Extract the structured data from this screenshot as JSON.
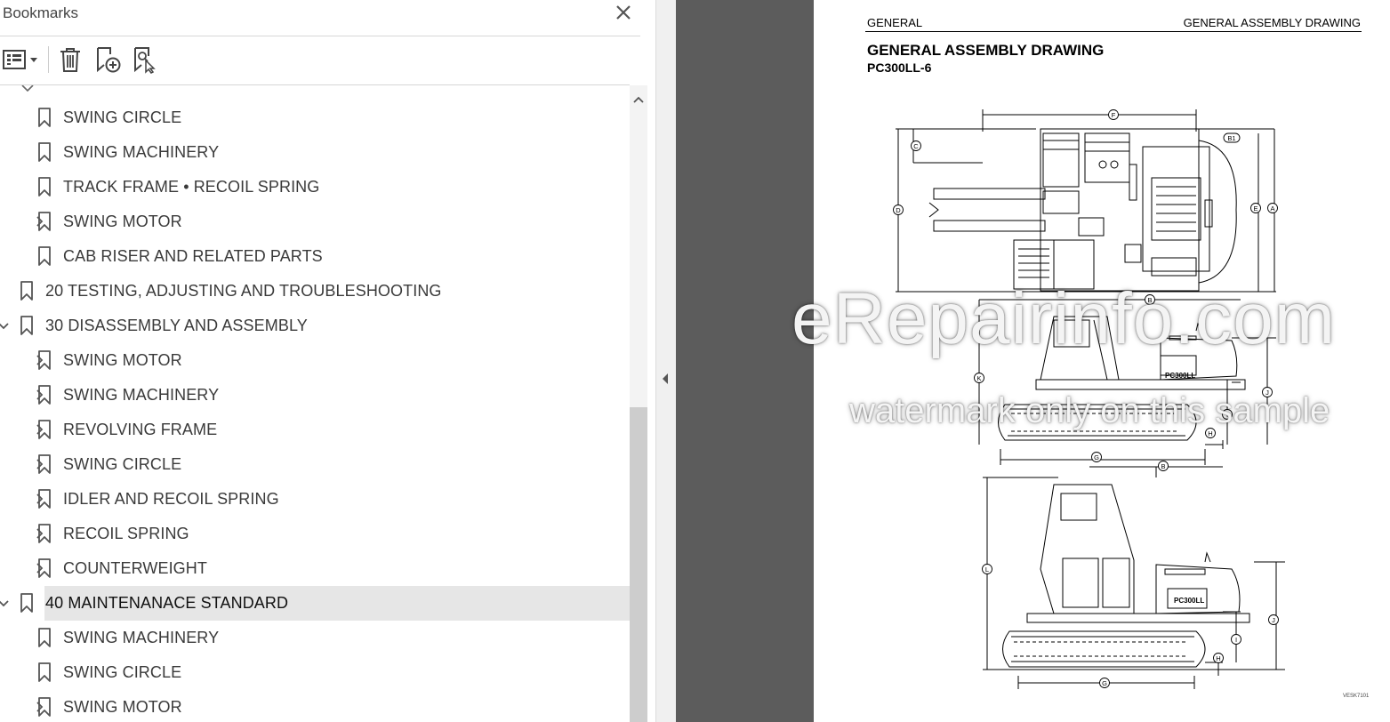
{
  "panel": {
    "title": "Bookmarks",
    "toolbar": {
      "options_icon": "list-options-icon",
      "delete_icon": "trash-icon",
      "new_bookmark_icon": "add-bookmark-icon",
      "find_bookmark_icon": "find-bookmark-icon"
    },
    "items": [
      {
        "label": "SWING CIRCLE",
        "level": 2,
        "expander": "none"
      },
      {
        "label": "SWING MACHINERY",
        "level": 2,
        "expander": "none"
      },
      {
        "label": "TRACK FRAME • RECOIL SPRING",
        "level": 2,
        "expander": "none"
      },
      {
        "label": "SWING MOTOR",
        "level": 2,
        "expander": "collapsed"
      },
      {
        "label": "CAB RISER AND RELATED PARTS",
        "level": 2,
        "expander": "none"
      },
      {
        "label": "20 TESTING, ADJUSTING AND TROUBLESHOOTING",
        "level": 1,
        "expander": "none"
      },
      {
        "label": "30 DISASSEMBLY AND ASSEMBLY",
        "level": 1,
        "expander": "expanded"
      },
      {
        "label": "SWING MOTOR",
        "level": 2,
        "expander": "collapsed"
      },
      {
        "label": "SWING MACHINERY",
        "level": 2,
        "expander": "collapsed"
      },
      {
        "label": "REVOLVING FRAME",
        "level": 2,
        "expander": "collapsed"
      },
      {
        "label": "SWING CIRCLE",
        "level": 2,
        "expander": "collapsed"
      },
      {
        "label": "IDLER AND RECOIL SPRING",
        "level": 2,
        "expander": "collapsed"
      },
      {
        "label": "RECOIL SPRING",
        "level": 2,
        "expander": "collapsed"
      },
      {
        "label": "COUNTERWEIGHT",
        "level": 2,
        "expander": "collapsed"
      },
      {
        "label": "40 MAINTENANACE STANDARD",
        "level": 1,
        "expander": "expanded",
        "selected": true
      },
      {
        "label": "SWING MACHINERY",
        "level": 2,
        "expander": "none"
      },
      {
        "label": "SWING CIRCLE",
        "level": 2,
        "expander": "none"
      },
      {
        "label": "SWING MOTOR",
        "level": 2,
        "expander": "collapsed"
      }
    ]
  },
  "document": {
    "header_left": "GENERAL",
    "header_right": "GENERAL ASSEMBLY DRAWING",
    "title": "GENERAL ASSEMBLY DRAWING",
    "model": "PC300LL-6",
    "figure_code": "VESK7101",
    "machine_label": "PC300LL",
    "dimension_labels": {
      "F": "F",
      "C": "C",
      "B1": "B1",
      "D": "D",
      "E": "E",
      "A": "A",
      "B": "B",
      "K": "K",
      "J": "J",
      "I": "I",
      "H": "H",
      "G": "G",
      "L": "L"
    }
  },
  "watermark": {
    "line1": "eRepairinfo.com",
    "line2": "watermark only on this sample"
  }
}
